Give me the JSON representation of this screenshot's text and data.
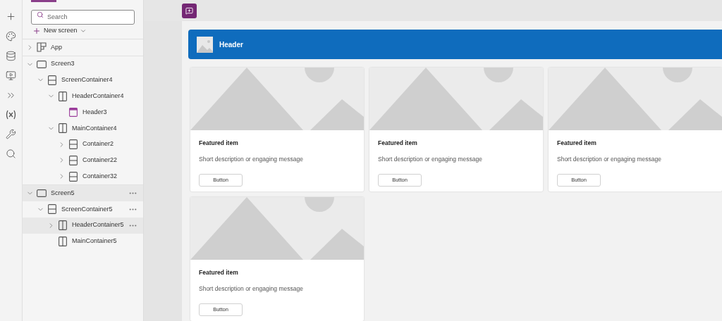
{
  "tree_panel": {
    "search": {
      "placeholder": "Search"
    },
    "new_screen": "New screen",
    "items": [
      {
        "label": "App",
        "kind": "app",
        "expanded": false,
        "highlighted": false,
        "more": false
      },
      {
        "label": "Screen3",
        "kind": "screen",
        "expanded": true,
        "highlighted": false,
        "more": false,
        "children": [
          {
            "label": "ScreenContainer4",
            "kind": "vertical",
            "expanded": true,
            "highlighted": false,
            "more": false,
            "children": [
              {
                "label": "HeaderContainer4",
                "kind": "horizontal",
                "expanded": true,
                "highlighted": false,
                "more": false,
                "children": [
                  {
                    "label": "Header3",
                    "kind": "header",
                    "highlighted": false,
                    "more": false
                  }
                ]
              },
              {
                "label": "MainContainer4",
                "kind": "horizontal",
                "expanded": true,
                "highlighted": false,
                "more": false,
                "children": [
                  {
                    "label": "Container2",
                    "kind": "vertical",
                    "expanded": false,
                    "highlighted": false,
                    "more": false
                  },
                  {
                    "label": "Container22",
                    "kind": "vertical",
                    "expanded": false,
                    "highlighted": false,
                    "more": false
                  },
                  {
                    "label": "Container32",
                    "kind": "vertical",
                    "expanded": false,
                    "highlighted": false,
                    "more": false
                  }
                ]
              }
            ]
          }
        ]
      },
      {
        "label": "Screen5",
        "kind": "screen",
        "expanded": true,
        "highlighted": true,
        "more": true,
        "children": [
          {
            "label": "ScreenContainer5",
            "kind": "vertical",
            "expanded": true,
            "highlighted": false,
            "more": true,
            "children": [
              {
                "label": "HeaderContainer5",
                "kind": "horizontal",
                "expanded": false,
                "highlighted": true,
                "more": true
              },
              {
                "label": "MainContainer5",
                "kind": "horizontal",
                "highlighted": false,
                "more": false
              }
            ]
          }
        ]
      }
    ]
  },
  "canvas": {
    "header": {
      "title": "Header"
    },
    "cards": [
      {
        "title": "Featured item",
        "description": "Short description or engaging message",
        "button": "Button"
      },
      {
        "title": "Featured item",
        "description": "Short description or engaging message",
        "button": "Button"
      },
      {
        "title": "Featured item",
        "description": "Short description or engaging message",
        "button": "Button"
      },
      {
        "title": "Featured item",
        "description": "Short description or engaging message",
        "button": "Button"
      }
    ]
  }
}
